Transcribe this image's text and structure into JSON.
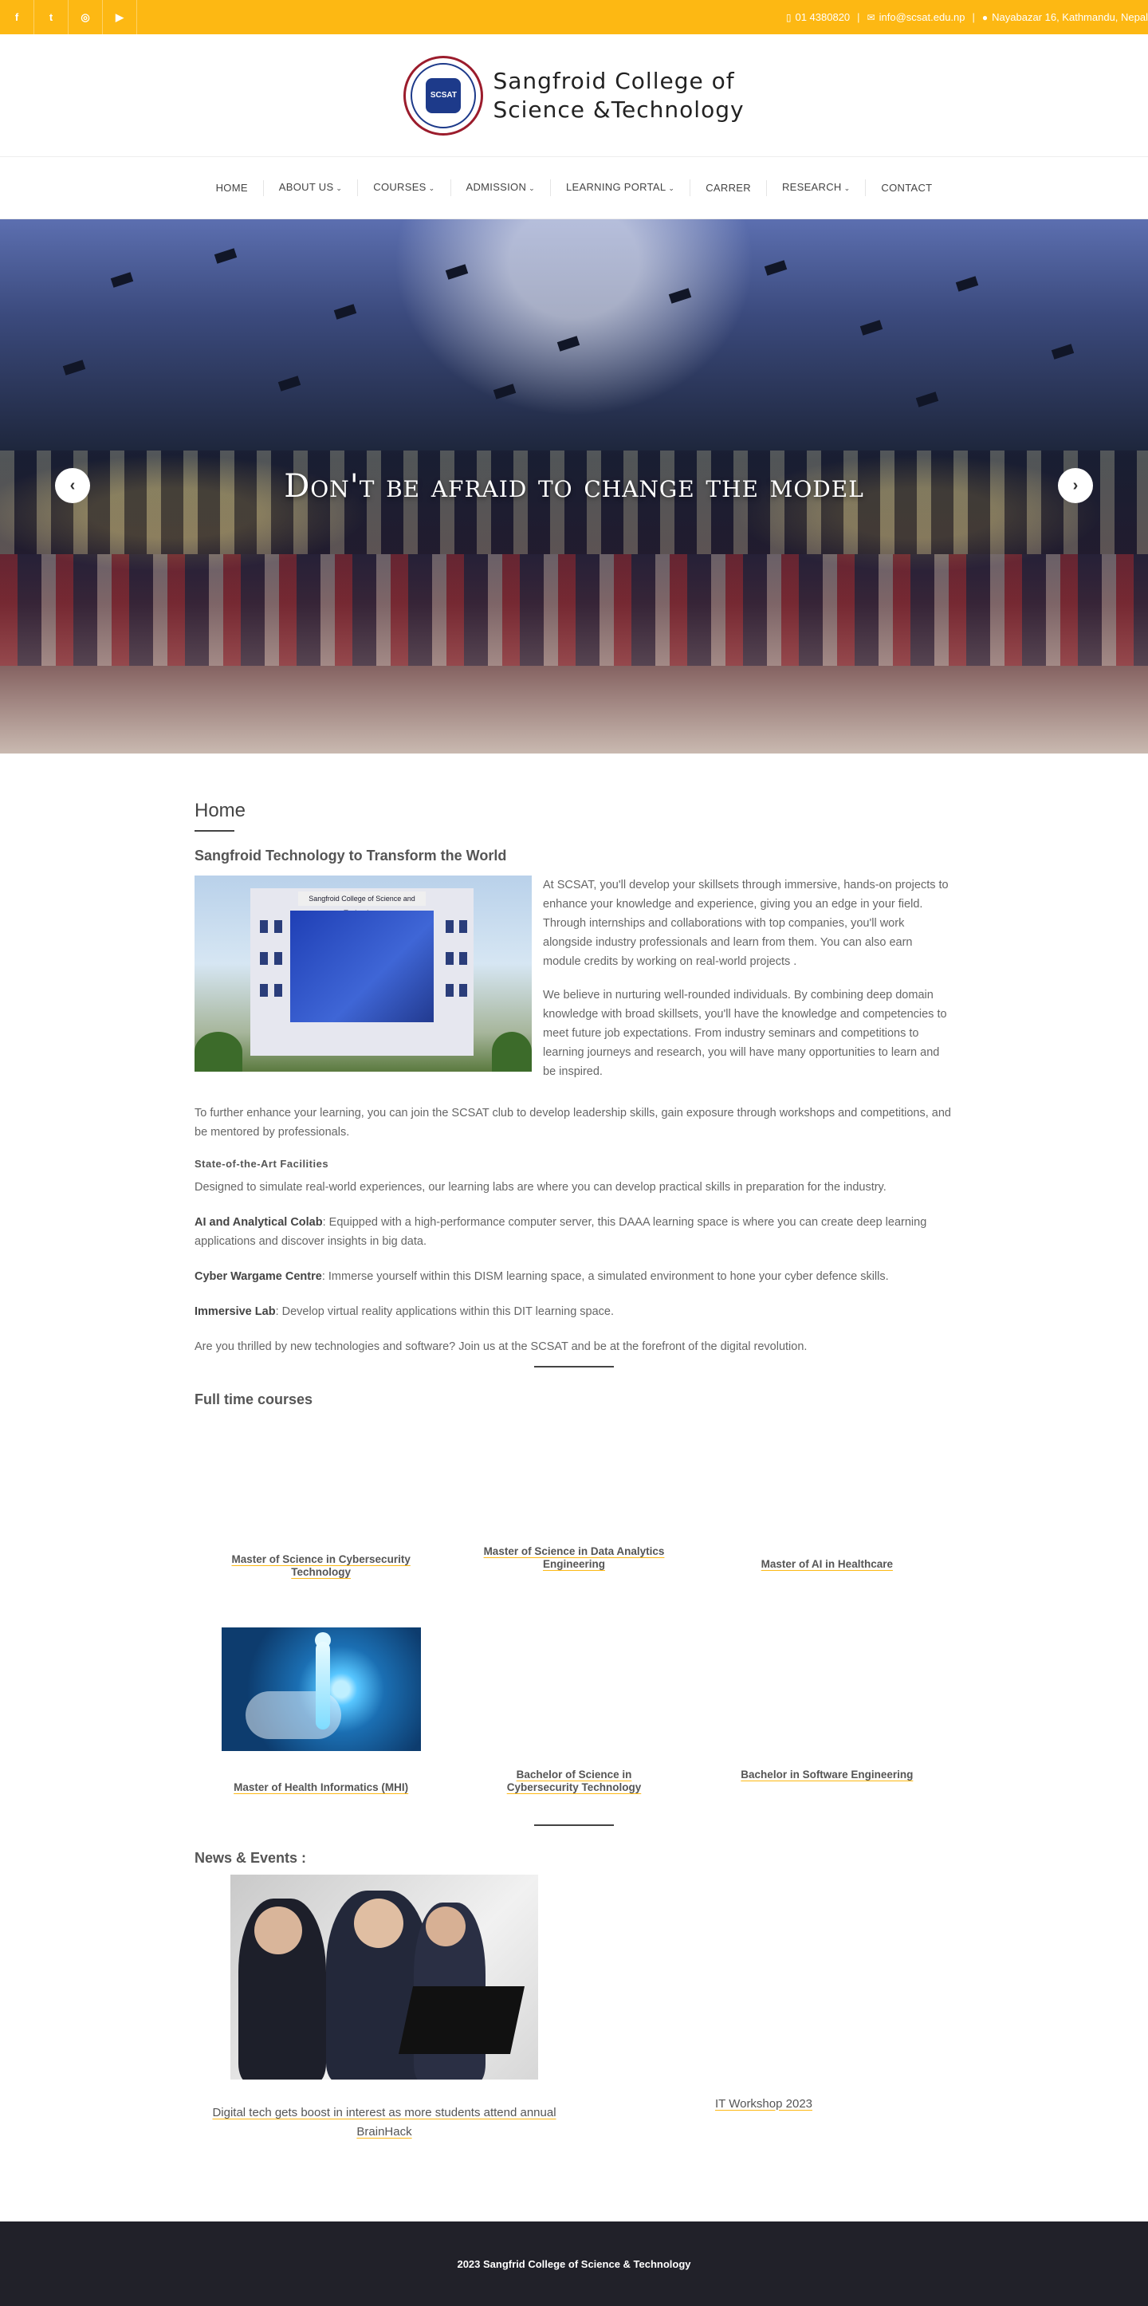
{
  "topbar": {
    "socials": [
      {
        "icon": "facebook-icon",
        "glyph": "f"
      },
      {
        "icon": "twitter-icon",
        "glyph": "t"
      },
      {
        "icon": "instagram-icon",
        "glyph": "◎"
      },
      {
        "icon": "youtube-icon",
        "glyph": "▶"
      }
    ],
    "phone": "01 4380820",
    "email": "info@scsat.edu.np",
    "address": "Nayabazar 16, Kathmandu, Nepal",
    "color": "#fdb813"
  },
  "brand": {
    "line1": "Sangfroid College of",
    "line2": "Science &Technology",
    "seal_text": "SCSAT"
  },
  "nav": {
    "home": "HOME",
    "about": "ABOUT US",
    "courses": "COURSES",
    "admission": "ADMISSION",
    "portal": "LEARNING PORTAL",
    "career": "CARRER",
    "research": "RESEARCH",
    "contact": "CONTACT"
  },
  "hero": {
    "title": "Don't be afraid to change the model"
  },
  "main": {
    "title": "Home",
    "subtitle": "Sangfroid Technology to Transform the World",
    "building_sign": "Sangfroid College of Science and Technology",
    "intro_p1": "At SCSAT, you'll develop your skillsets through immersive, hands-on projects to enhance your knowledge and experience, giving you an edge in your field. Through internships and collaborations with top companies, you'll work alongside industry professionals and learn from them. You can also earn module credits by working on real-world projects .",
    "intro_p2": "We believe in nurturing well-rounded individuals. By combining deep domain knowledge with broad skillsets, you'll have the knowledge and competencies to meet future job expectations. From industry seminars and competitions to learning journeys and research, you will have many opportunities to learn and be inspired.",
    "club_p": "To further enhance your learning, you can join the SCSAT club to develop leadership skills, gain exposure through workshops and competitions, and be mentored by professionals.",
    "facilities_h": "State-of-the-Art Facilities",
    "facilities_p": "Designed to simulate real-world experiences, our learning labs are where you can develop practical skills in preparation for the industry.",
    "ai_label": "AI and Analytical Colab",
    "ai_text": ": Equipped with a high-performance computer server, this DAAA learning space is where you can create deep learning applications and discover insights in big data.",
    "cyber_label": "Cyber Wargame Centre",
    "cyber_text": ": Immerse yourself within this DISM learning space, a simulated environment to hone your cyber defence skills.",
    "immersive_label": "Immersive Lab",
    "immersive_text": ": Develop virtual reality applications within this DIT learning space.",
    "closing_p": "Are you thrilled by new technologies and software? Join us at the SCSAT and be at the forefront of the digital revolution."
  },
  "courses": {
    "title": "Full time courses",
    "items": [
      "Master of Science in Cybersecurity Technology",
      "Master of Science in Data Analytics Engineering",
      "Master of AI in Healthcare",
      "Master of Health Informatics (MHI)",
      "Bachelor of Science in Cybersecurity Technology",
      "Bachelor in Software Engineering"
    ]
  },
  "news": {
    "title": "News & Events :",
    "items": [
      "Digital tech gets boost in interest as more students attend annual BrainHack",
      "IT Workshop 2023"
    ]
  },
  "footer": {
    "text": "2023 Sangfrid College of Science & Technology"
  }
}
